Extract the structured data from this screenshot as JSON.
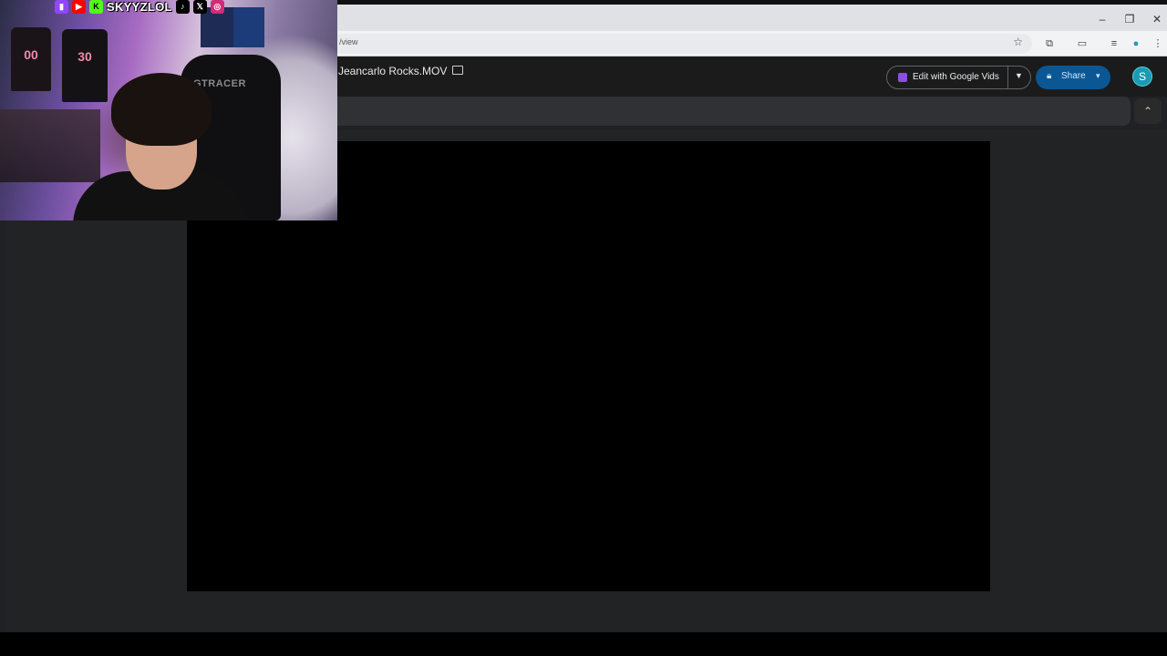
{
  "browser": {
    "url_fragment": "/view",
    "window_controls": {
      "minimize": "–",
      "restore": "❐",
      "close": "✕"
    }
  },
  "drive": {
    "file_title": "Jeancarlo Rocks.MOV",
    "edit_button_label": "Edit with Google Vids",
    "share_button_label": "Share",
    "avatar_glyph": "S"
  },
  "webcam": {
    "handle": "SKYYZLOL",
    "jersey_number_1": "00",
    "jersey_number_2": "30",
    "chair_brand": "GTRACER"
  },
  "colors": {
    "share_bg": "#0b5794",
    "vids_accent": "#8c4fdd",
    "viewer_bg": "#222325"
  }
}
